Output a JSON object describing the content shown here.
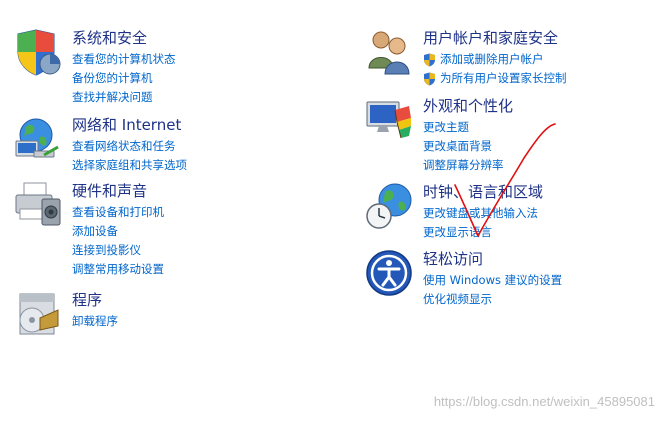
{
  "categories": {
    "system": {
      "title": "系统和安全",
      "links": [
        "查看您的计算机状态",
        "备份您的计算机",
        "查找并解决问题"
      ]
    },
    "network": {
      "title": "网络和 Internet",
      "links": [
        "查看网络状态和任务",
        "选择家庭组和共享选项"
      ]
    },
    "hardware": {
      "title": "硬件和声音",
      "links": [
        "查看设备和打印机",
        "添加设备",
        "连接到投影仪",
        "调整常用移动设置"
      ]
    },
    "programs": {
      "title": "程序",
      "links": [
        "卸载程序"
      ]
    },
    "users": {
      "title": "用户帐户和家庭安全",
      "links": [
        "添加或删除用户帐户",
        "为所有用户设置家长控制"
      ]
    },
    "appearance": {
      "title": "外观和个性化",
      "links": [
        "更改主题",
        "更改桌面背景",
        "调整屏幕分辨率"
      ]
    },
    "clock": {
      "title": "时钟、语言和区域",
      "links": [
        "更改键盘或其他输入法",
        "更改显示语言"
      ]
    },
    "ease": {
      "title": "轻松访问",
      "links": [
        "使用 Windows 建议的设置",
        "优化视频显示"
      ]
    }
  },
  "watermark": "https://blog.csdn.net/weixin_45895081",
  "annotation_color": "#e01010"
}
